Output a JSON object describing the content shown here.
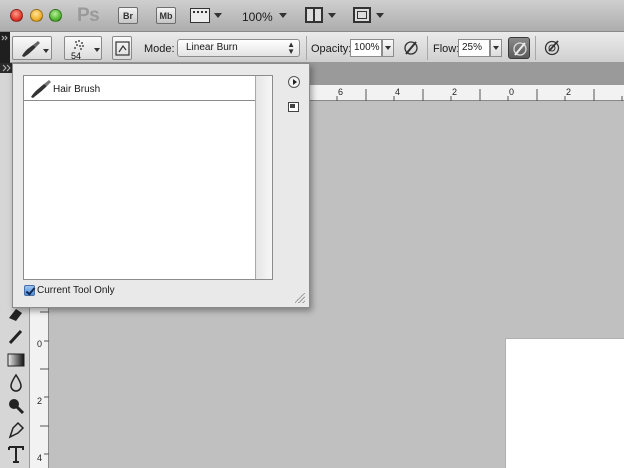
{
  "appbar": {
    "logo": "Ps",
    "bridge_label": "Br",
    "mini_bridge_label": "Mb",
    "zoom_level": "100%"
  },
  "options": {
    "brush_size": "54",
    "mode_label": "Mode:",
    "mode_value": "Linear Burn",
    "opacity_label": "Opacity:",
    "opacity_value": "100%",
    "flow_label": "Flow:",
    "flow_value": "25%"
  },
  "preset_popup": {
    "items": [
      {
        "label": "Hair Brush"
      }
    ],
    "current_tool_only_label": "Current Tool Only",
    "current_tool_only_checked": true
  },
  "rulers": {
    "top": [
      "6",
      "4",
      "2",
      "0",
      "2"
    ],
    "left": [
      "0",
      "2",
      "4"
    ]
  },
  "colors": {
    "canvas_background": "#c0c0c0",
    "document": "#ffffff",
    "checkbox_accent": "#4e8fdc"
  }
}
